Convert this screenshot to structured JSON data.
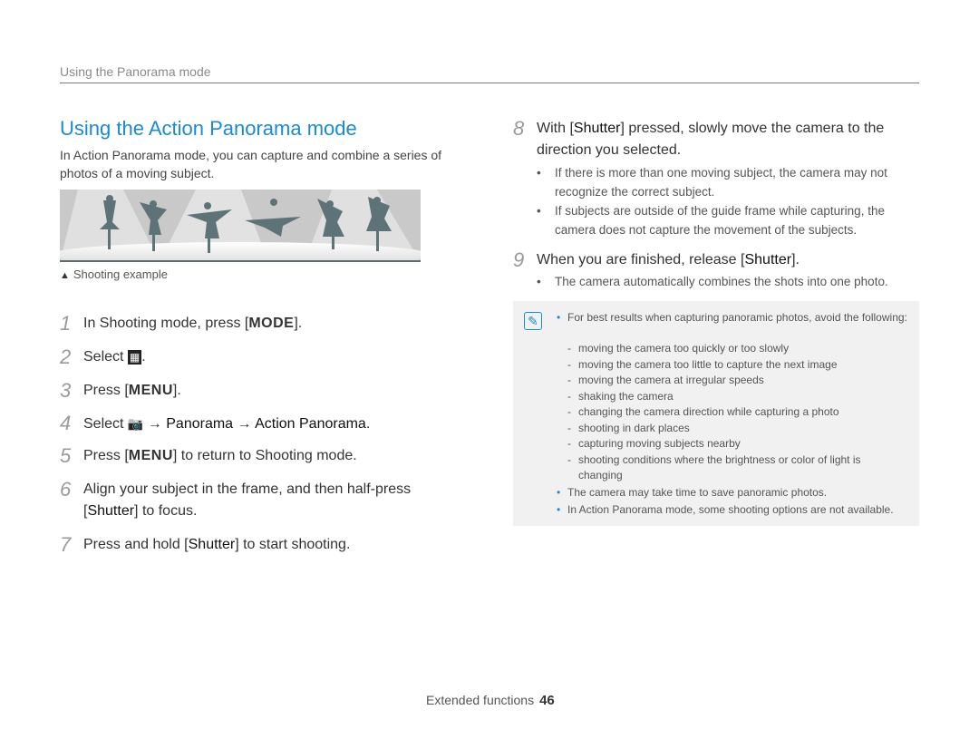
{
  "header": {
    "section": "Using the Panorama mode"
  },
  "title": "Using the Action Panorama mode",
  "intro": "In Action Panorama mode, you can capture and combine a series of photos of a moving subject.",
  "caption": {
    "marker": "▲",
    "text": "Shooting example"
  },
  "steps_left": [
    {
      "num": "1",
      "parts": [
        "In Shooting mode, press [",
        "MODE",
        "]."
      ]
    },
    {
      "num": "2",
      "parts": [
        "Select ",
        "▦",
        "."
      ]
    },
    {
      "num": "3",
      "parts": [
        "Press [",
        "MENU",
        "]."
      ]
    },
    {
      "num": "4",
      "parts": [
        "Select ",
        "📷",
        " → ",
        "Panorama",
        " → ",
        "Action Panorama",
        "."
      ]
    },
    {
      "num": "5",
      "parts": [
        "Press [",
        "MENU",
        "] to return to Shooting mode."
      ]
    },
    {
      "num": "6",
      "parts": [
        "Align your subject in the frame, and then half-press [",
        "Shutter",
        "] to focus."
      ]
    },
    {
      "num": "7",
      "parts": [
        "Press and hold [",
        "Shutter",
        "] to start shooting."
      ]
    }
  ],
  "steps_right": [
    {
      "num": "8",
      "text_a": "With [",
      "key": "Shutter",
      "text_b": "] pressed, slowly move the camera to the direction you selected.",
      "bullets": [
        "If there is more than one moving subject, the camera may not recognize the correct subject.",
        "If subjects are outside of the guide frame while capturing, the camera does not capture the movement of the subjects."
      ]
    },
    {
      "num": "9",
      "text_a": "When you are finished, release [",
      "key": "Shutter",
      "text_b": "].",
      "bullets": [
        "The camera automatically combines the shots into one photo."
      ]
    }
  ],
  "note": {
    "icon": "note-icon",
    "bullet1": "For best results when capturing panoramic photos, avoid the following:",
    "subitems": [
      "moving the camera too quickly or too slowly",
      "moving the camera too little to capture the next image",
      "moving the camera at irregular speeds",
      "shaking the camera",
      "changing the camera direction while capturing a photo",
      "shooting in dark places",
      "capturing moving subjects nearby",
      "shooting conditions where the brightness or color of light is changing"
    ],
    "bullet2": "The camera may take time to save panoramic photos.",
    "bullet3": "In Action Panorama mode, some shooting options are not available."
  },
  "footer": {
    "label": "Extended functions",
    "page": "46"
  },
  "colors": {
    "accent": "#1a8bd2",
    "note_bg": "#f1f1f1"
  }
}
